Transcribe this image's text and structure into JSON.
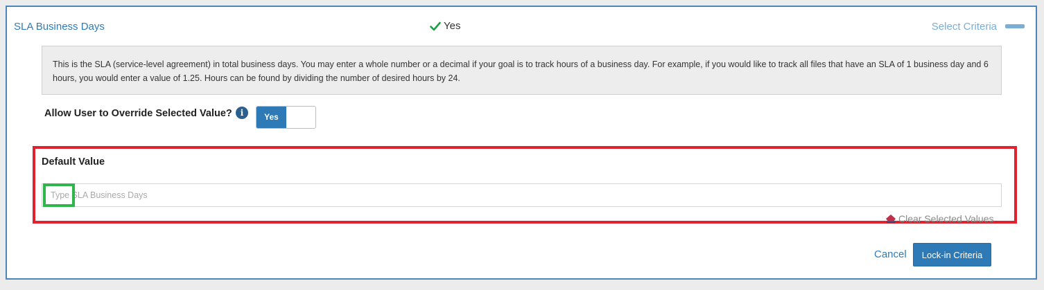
{
  "header": {
    "title": "SLA Business Days",
    "status_text": "Yes",
    "status_icon": "check-icon",
    "status_color": "#1f9d4a",
    "select_criteria_label": "Select Criteria",
    "collapse_icon": "minus-icon"
  },
  "info": {
    "text": "This is the SLA (service-level agreement) in total business days. You may enter a whole number or a decimal if your goal is to track hours of a business day. For example, if you would like to track all files that have an SLA of 1 business day and 6 hours, you would enter a value of 1.25. Hours can be found by dividing the number of desired hours by 24."
  },
  "override": {
    "label": "Allow User to Override Selected Value?",
    "info_icon": "info-icon",
    "toggle_label": "Yes",
    "toggle_state": "on"
  },
  "default_value": {
    "label": "Default Value",
    "input_value": "",
    "input_placeholder": "Type SLA Business Days",
    "clear_label": "Clear Selected Values",
    "clear_icon": "eraser-icon"
  },
  "actions": {
    "cancel_label": "Cancel",
    "lock_label": "Lock-in Criteria"
  },
  "colors": {
    "accent": "#2d7ab6",
    "highlight_red": "#e2212f",
    "highlight_green": "#2fb64a"
  }
}
